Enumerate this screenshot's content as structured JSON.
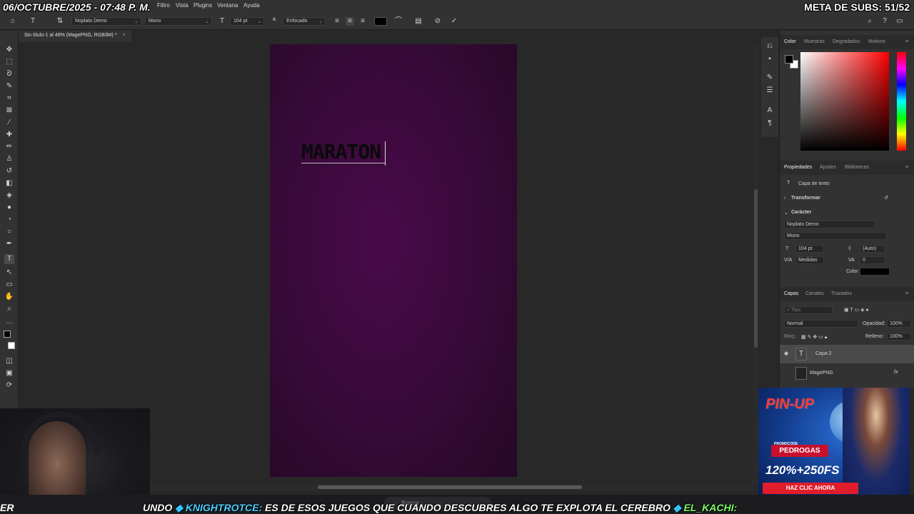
{
  "overlay": {
    "date": "06/OCTUBRE/2025 - 07:48 P. M.",
    "subs": "META DE SUBS: 51/52"
  },
  "menu": {
    "items": [
      "Filtro",
      "Vista",
      "Plugins",
      "Ventana",
      "Ayuda"
    ]
  },
  "options": {
    "font_family": "Noplato Demo",
    "font_style": "Mono",
    "font_size": "104 pt",
    "antialias": "Enfocado"
  },
  "document": {
    "tab_title": "Sin título-1 al 48% (MagePNG, RGB/8#) *",
    "canvas_text": "MARATON"
  },
  "color_panel": {
    "tabs": [
      "Color",
      "Muestras",
      "Degradados",
      "Motivos"
    ],
    "fg": "#000000",
    "bg": "#ffffff"
  },
  "properties_panel": {
    "tabs": [
      "Propiedades",
      "Ajustes",
      "Bibliotecas"
    ],
    "layer_kind": "Capa de texto",
    "transform_label": "Transformar",
    "character_label": "Carácter",
    "font_family": "Noplato Demo",
    "font_style": "Mono",
    "font_size": "104 pt",
    "leading": "(Auto)",
    "kerning": "Medidas",
    "tracking": "0",
    "color_label": "Color"
  },
  "layers_panel": {
    "tabs": [
      "Capas",
      "Canales",
      "Trazados"
    ],
    "search_placeholder": "Tipo",
    "blend_mode": "Normal",
    "opacity_label": "Opacidad:",
    "opacity_value": "100%",
    "lock_label": "Bloq.:",
    "fill_label": "Relleno:",
    "fill_value": "100%",
    "layers": [
      {
        "name": "Capa 2",
        "thumb": "T"
      },
      {
        "name": "MagePNG",
        "thumb": ""
      }
    ],
    "fx_label": "fx"
  },
  "ad": {
    "logo": "PIN-UP",
    "promo_label": "PROMOCODE",
    "promo_code": "PEDROGAS",
    "bonus": "120%+250FS",
    "cta": "HAZ CLIC AHORA"
  },
  "ticker": {
    "prefix": "UNDO",
    "user1": "KNIGHTROTCE:",
    "message1": "ES DE ESOS JUEGOS QUE CUANDO DESCUBRES ALGO TE EXPLOTA EL CEREBRO",
    "user2": "EL_KACHI:",
    "left_fragment": "ER"
  },
  "taskbar": {
    "search_placeholder": "Buscar"
  }
}
